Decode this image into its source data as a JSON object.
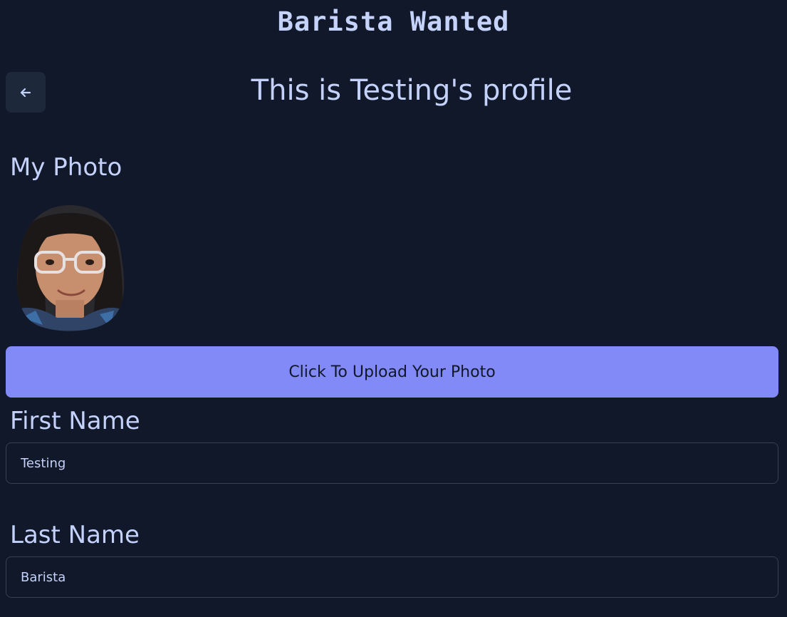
{
  "header": {
    "app_title": "Barista Wanted"
  },
  "nav": {
    "back_icon": "arrow-left-icon"
  },
  "profile": {
    "page_title": "This is Testing's profile",
    "photo_label": "My Photo",
    "upload_label": "Click To Upload Your Photo",
    "first_name_label": "First Name",
    "first_name_value": "Testing",
    "last_name_label": "Last Name",
    "last_name_value": "Barista"
  },
  "colors": {
    "background": "#111829",
    "text": "#c3d1fb",
    "accent": "#818af7",
    "field_border": "#374152",
    "back_button_bg": "#1d283a"
  }
}
